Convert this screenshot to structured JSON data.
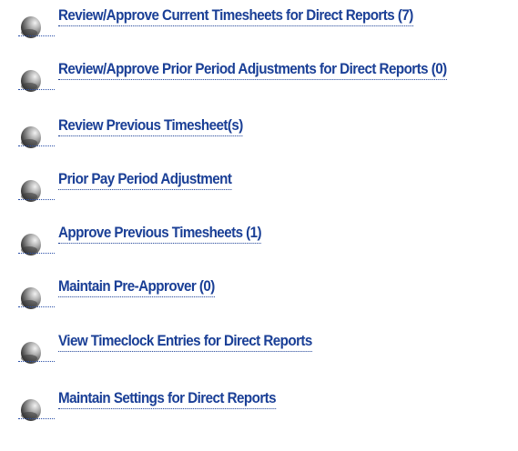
{
  "menu": {
    "items": [
      {
        "label": "Review/Approve Current Timesheets for Direct Reports (7)",
        "icon": "grey-sphere-bullet-icon"
      },
      {
        "label": "Review/Approve Prior Period Adjustments for Direct Reports (0)",
        "icon": "grey-sphere-bullet-icon"
      },
      {
        "label": "Review Previous Timesheet(s)",
        "icon": "grey-sphere-bullet-icon"
      },
      {
        "label": "Prior Pay Period Adjustment",
        "icon": "grey-sphere-bullet-icon"
      },
      {
        "label": "Approve Previous Timesheets (1)",
        "icon": "grey-sphere-bullet-icon"
      },
      {
        "label": "Maintain Pre-Approver (0)",
        "icon": "grey-sphere-bullet-icon"
      },
      {
        "label": "View Timeclock Entries for Direct Reports",
        "icon": "grey-sphere-bullet-icon"
      },
      {
        "label": "Maintain Settings for Direct Reports",
        "icon": "grey-sphere-bullet-icon"
      }
    ]
  },
  "colors": {
    "link": "#1a3f96",
    "background": "#ffffff",
    "bullet_dark": "#2b2b2b",
    "bullet_light": "#e6e6e6"
  }
}
